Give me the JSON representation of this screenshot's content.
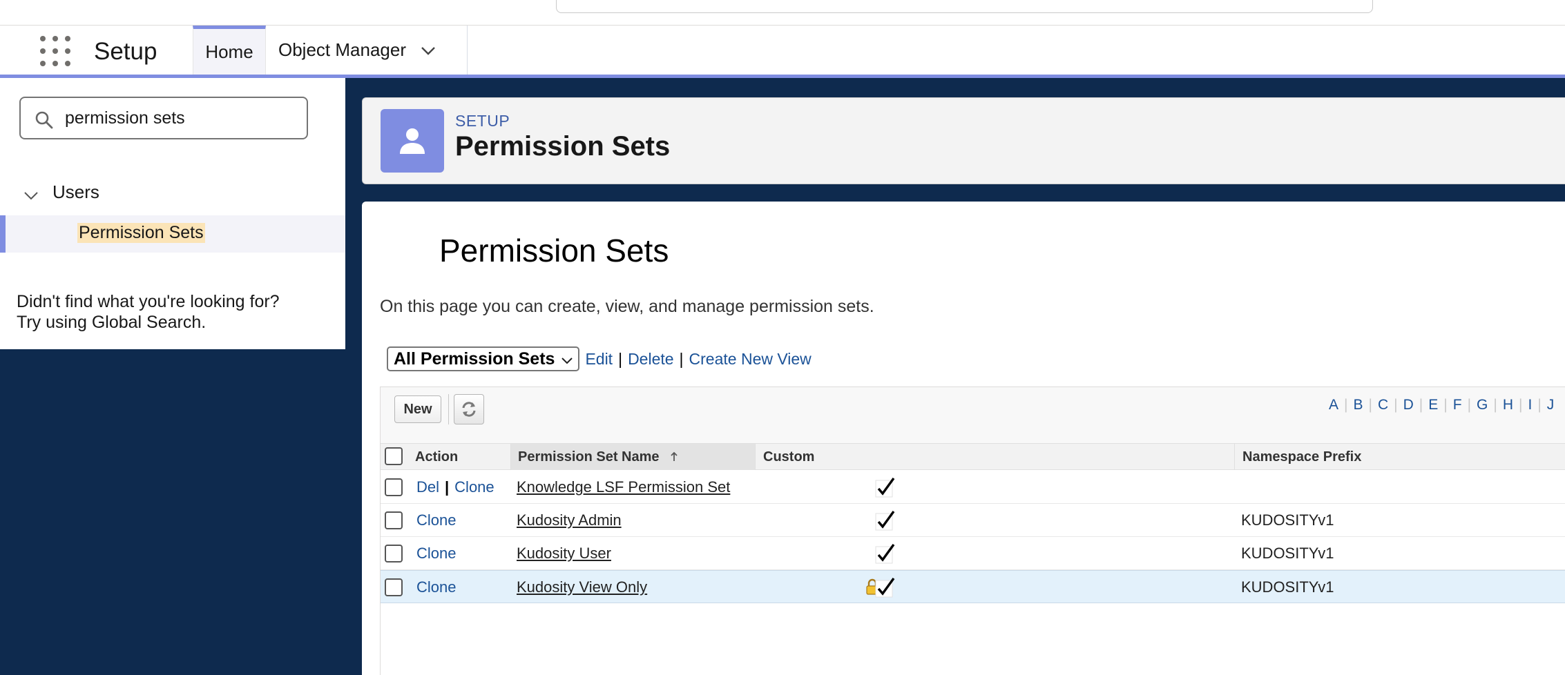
{
  "app": {
    "name": "Setup",
    "tabs": [
      {
        "label": "Home"
      },
      {
        "label": "Object Manager"
      }
    ]
  },
  "sidebar": {
    "search_value": "permission sets",
    "tree": {
      "parent_label": "Users",
      "child_label": "Permission Sets"
    },
    "not_found_line1": "Didn't find what you're looking for?",
    "not_found_line2": "Try using Global Search."
  },
  "header": {
    "eyebrow": "SETUP",
    "title": "Permission Sets"
  },
  "content": {
    "title": "Permission Sets",
    "description": "On this page you can create, view, and manage permission sets.",
    "view_select": "All Permission Sets",
    "view_links": {
      "edit": "Edit",
      "delete": "Delete",
      "create": "Create New View"
    },
    "toolbar": {
      "new_label": "New"
    },
    "alphabet": [
      "A",
      "B",
      "C",
      "D",
      "E",
      "F",
      "G",
      "H",
      "I",
      "J"
    ],
    "columns": {
      "action": "Action",
      "name": "Permission Set Name",
      "custom": "Custom",
      "namespace": "Namespace Prefix"
    },
    "rows": [
      {
        "del": "Del",
        "clone": "Clone",
        "name": "Knowledge LSF Permission Set",
        "custom": true,
        "namespace": ""
      },
      {
        "del": "",
        "clone": "Clone",
        "name": "Kudosity Admin",
        "custom": true,
        "namespace": "KUDOSITYv1"
      },
      {
        "del": "",
        "clone": "Clone",
        "name": "Kudosity User",
        "custom": true,
        "namespace": "KUDOSITYv1"
      },
      {
        "del": "",
        "clone": "Clone",
        "name": "Kudosity View Only",
        "custom": true,
        "namespace": "KUDOSITYv1",
        "locked": true
      }
    ]
  }
}
